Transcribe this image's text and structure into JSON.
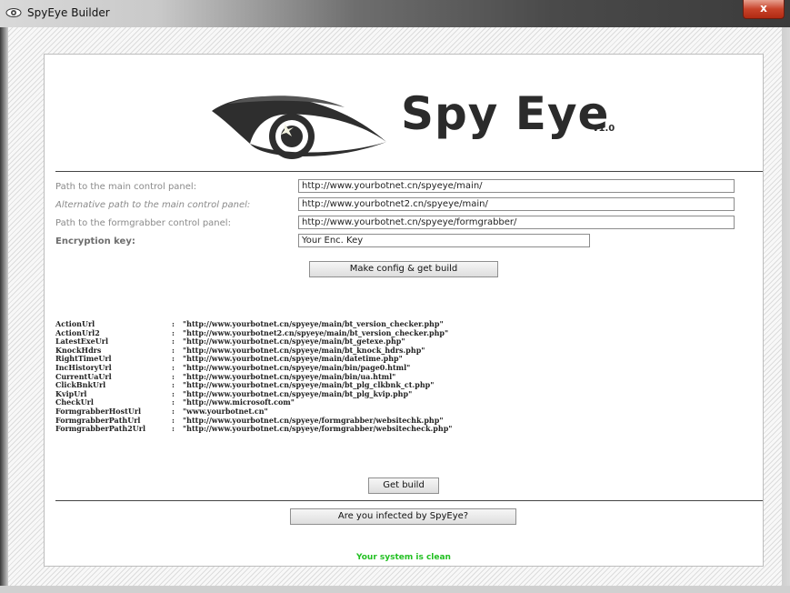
{
  "window": {
    "title": "SpyEye Builder",
    "close_label": "x"
  },
  "logo": {
    "brand": "Spy Eye",
    "version": "v1.0"
  },
  "form": {
    "main_panel_label": "Path to the main control panel:",
    "main_panel_value": "http://www.yourbotnet.cn/spyeye/main/",
    "alt_panel_label": "Alternative path to the main control panel:",
    "alt_panel_value": "http://www.yourbotnet2.cn/spyeye/main/",
    "formgrabber_label": "Path to the formgrabber control panel:",
    "formgrabber_value": "http://www.yourbotnet.cn/spyeye/formgrabber/",
    "enc_key_label": "Encryption key:",
    "enc_key_value": "Your Enc. Key",
    "make_config_button": "Make config & get build"
  },
  "config": [
    {
      "key": "ActionUrl",
      "value": "\"http://www.yourbotnet.cn/spyeye/main/bt_version_checker.php\""
    },
    {
      "key": "ActionUrl2",
      "value": "\"http://www.yourbotnet2.cn/spyeye/main/bt_version_checker.php\""
    },
    {
      "key": "LatestExeUrl",
      "value": "\"http://www.yourbotnet.cn/spyeye/main/bt_getexe.php\""
    },
    {
      "key": "KnockHdrs",
      "value": "\"http://www.yourbotnet.cn/spyeye/main/bt_knock_hdrs.php\""
    },
    {
      "key": "RightTimeUrl",
      "value": "\"http://www.yourbotnet.cn/spyeye/main/datetime.php\""
    },
    {
      "key": "IncHistoryUrl",
      "value": "\"http://www.yourbotnet.cn/spyeye/main/bin/page0.html\""
    },
    {
      "key": "CurrentUaUrl",
      "value": "\"http://www.yourbotnet.cn/spyeye/main/bin/ua.html\""
    },
    {
      "key": "ClickBnkUrl",
      "value": "\"http://www.yourbotnet.cn/spyeye/main/bt_plg_clkbnk_ct.php\""
    },
    {
      "key": "KvipUrl",
      "value": "\"http://www.yourbotnet.cn/spyeye/main/bt_plg_kvip.php\""
    },
    {
      "key": "CheckUrl",
      "value": "\"http://www.microsoft.com\""
    },
    {
      "key": "FormgrabberHostUrl",
      "value": "\"www.yourbotnet.cn\""
    },
    {
      "key": "FormgrabberPathUrl",
      "value": "\"http://www.yourbotnet.cn/spyeye/formgrabber/websitechk.php\""
    },
    {
      "key": "FormgrabberPath2Url",
      "value": "\"http://www.yourbotnet.cn/spyeye/formgrabber/websitecheck.php\""
    }
  ],
  "config_separator": ":",
  "actions": {
    "get_build_button": "Get build",
    "infected_check_button": "Are you infected by SpyEye?",
    "status_text": "Your system is clean"
  },
  "colors": {
    "status_green": "#22c022"
  }
}
